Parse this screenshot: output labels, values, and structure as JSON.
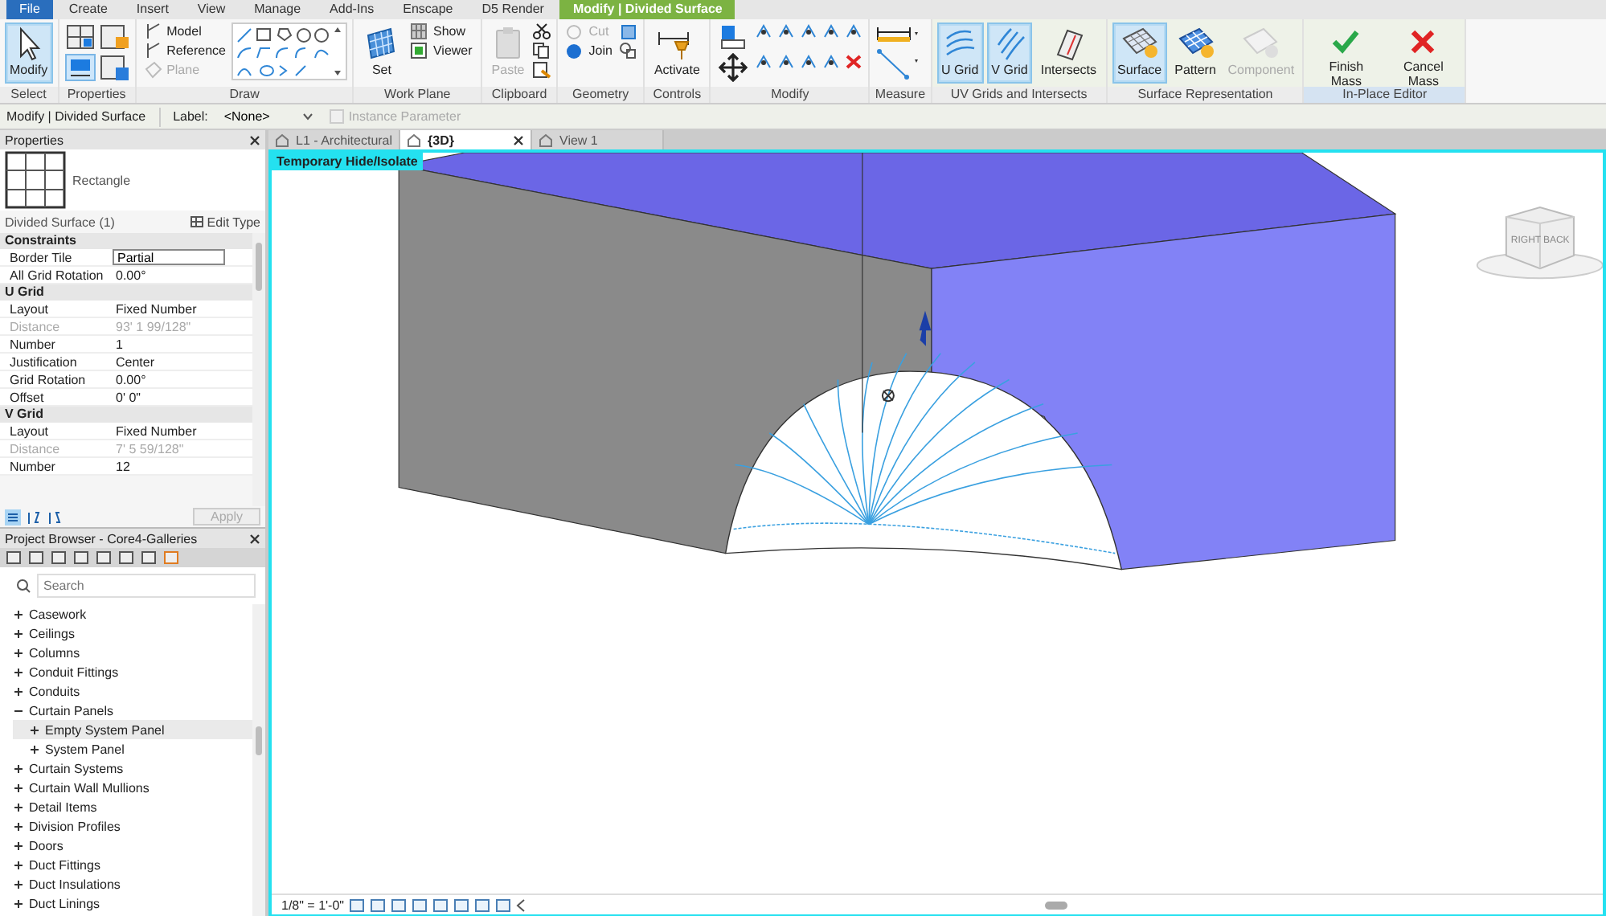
{
  "menu_tabs": [
    {
      "label": "File",
      "selected": false,
      "kind": "file"
    },
    {
      "label": "Create",
      "selected": false,
      "kind": "tab"
    },
    {
      "label": "Insert",
      "selected": false,
      "kind": "tab"
    },
    {
      "label": "View",
      "selected": false,
      "kind": "tab"
    },
    {
      "label": "Manage",
      "selected": false,
      "kind": "tab"
    },
    {
      "label": "Add-Ins",
      "selected": false,
      "kind": "tab"
    },
    {
      "label": "Enscape",
      "selected": false,
      "kind": "tab"
    },
    {
      "label": "D5 Render",
      "selected": false,
      "kind": "tab"
    },
    {
      "label": "Modify | Divided Surface",
      "selected": true,
      "kind": "context"
    }
  ],
  "ribbon": {
    "panels": [
      {
        "kind": "select",
        "title": "Select",
        "buttons": [
          {
            "label": "Modify",
            "kind": "large",
            "selected": true,
            "disabled": false
          }
        ]
      },
      {
        "kind": "properties",
        "title": "Properties"
      },
      {
        "kind": "draw",
        "title": "Draw",
        "buttons": [
          {
            "label": "Model",
            "kind": "small",
            "disabled": false
          },
          {
            "label": "Reference",
            "kind": "small",
            "disabled": false
          },
          {
            "label": "Plane",
            "kind": "small",
            "disabled": true
          }
        ]
      },
      {
        "kind": "work_plane",
        "title": "Work Plane",
        "buttons": [
          {
            "label": "Set",
            "kind": "large",
            "selected": false,
            "disabled": false
          },
          {
            "label": "Show",
            "kind": "small",
            "disabled": false
          },
          {
            "label": "Viewer",
            "kind": "small",
            "disabled": false
          }
        ]
      },
      {
        "kind": "clipboard",
        "title": "Clipboard",
        "buttons": [
          {
            "label": "Paste",
            "kind": "large",
            "selected": false,
            "disabled": true
          }
        ]
      },
      {
        "kind": "geometry",
        "title": "Geometry",
        "buttons": [
          {
            "label": "Cut",
            "kind": "small",
            "disabled": true
          },
          {
            "label": "Join",
            "kind": "small",
            "disabled": false
          }
        ]
      },
      {
        "kind": "controls",
        "title": "Controls",
        "buttons": [
          {
            "label": "Activate",
            "kind": "large",
            "selected": false,
            "disabled": false
          }
        ]
      },
      {
        "kind": "modify",
        "title": "Modify"
      },
      {
        "kind": "measure",
        "title": "Measure"
      },
      {
        "kind": "uv",
        "title": "UV Grids and Intersects",
        "buttons": [
          {
            "label": "U Grid",
            "kind": "large",
            "selected": true,
            "disabled": false
          },
          {
            "label": "V Grid",
            "kind": "large",
            "selected": true,
            "disabled": false
          },
          {
            "label": "Intersects",
            "kind": "large",
            "selected": false,
            "disabled": false
          }
        ]
      },
      {
        "kind": "surface",
        "title": "Surface Representation",
        "buttons": [
          {
            "label": "Surface",
            "kind": "large",
            "selected": true,
            "disabled": false
          },
          {
            "label": "Pattern",
            "kind": "large",
            "selected": false,
            "disabled": false
          },
          {
            "label": "Component",
            "kind": "large",
            "selected": false,
            "disabled": true
          }
        ]
      },
      {
        "kind": "editor",
        "title": "In-Place Editor",
        "buttons": [
          {
            "label": "Finish Mass",
            "kind": "large",
            "selected": false,
            "disabled": false
          },
          {
            "label": "Cancel Mass",
            "kind": "large",
            "selected": false,
            "disabled": false
          }
        ]
      }
    ]
  },
  "options_bar": {
    "context": "Modify | Divided Surface",
    "label_caption": "Label:",
    "label_value": "<None>",
    "instance_parameter": {
      "label": "Instance Parameter",
      "checked": false,
      "disabled": true
    }
  },
  "properties": {
    "title": "Properties",
    "type_name": "Rectangle",
    "selector": "Divided Surface (1)",
    "edit_type": "Edit Type",
    "apply": "Apply",
    "groups": [
      {
        "title": "Constraints",
        "rows": [
          {
            "label": "Border Tile",
            "value": "Partial",
            "kind": "field",
            "disabled": false
          },
          {
            "label": "All Grid Rotation",
            "value": "0.00°",
            "kind": "text",
            "disabled": false
          }
        ]
      },
      {
        "title": "U Grid",
        "rows": [
          {
            "label": "Layout",
            "value": "Fixed Number",
            "kind": "text",
            "disabled": false
          },
          {
            "label": "Distance",
            "value": "93'  1 99/128\"",
            "kind": "text",
            "disabled": true
          },
          {
            "label": "Number",
            "value": "1",
            "kind": "text",
            "disabled": false
          },
          {
            "label": "Justification",
            "value": "Center",
            "kind": "text",
            "disabled": false
          },
          {
            "label": "Grid Rotation",
            "value": "0.00°",
            "kind": "text",
            "disabled": false
          },
          {
            "label": "Offset",
            "value": "0'  0\"",
            "kind": "text",
            "disabled": false
          }
        ]
      },
      {
        "title": "V Grid",
        "rows": [
          {
            "label": "Layout",
            "value": "Fixed Number",
            "kind": "text",
            "disabled": false
          },
          {
            "label": "Distance",
            "value": "7'  5 59/128\"",
            "kind": "text",
            "disabled": true
          },
          {
            "label": "Number",
            "value": "12",
            "kind": "text",
            "disabled": false
          }
        ]
      }
    ]
  },
  "project_browser": {
    "title": "Project Browser - Core4-Galleries",
    "search": {
      "placeholder": "Search"
    },
    "items": [
      {
        "label": "Casework",
        "expanded": false,
        "selected": false
      },
      {
        "label": "Ceilings",
        "expanded": false,
        "selected": false
      },
      {
        "label": "Columns",
        "expanded": false,
        "selected": false
      },
      {
        "label": "Conduit Fittings",
        "expanded": false,
        "selected": false
      },
      {
        "label": "Conduits",
        "expanded": false,
        "selected": false
      },
      {
        "label": "Curtain Panels",
        "expanded": true,
        "selected": false,
        "children": [
          {
            "label": "Empty System Panel",
            "expanded": false,
            "selected": true
          },
          {
            "label": "System Panel",
            "expanded": false,
            "selected": false
          }
        ]
      },
      {
        "label": "Curtain Systems",
        "expanded": false,
        "selected": false
      },
      {
        "label": "Curtain Wall Mullions",
        "expanded": false,
        "selected": false
      },
      {
        "label": "Detail Items",
        "expanded": false,
        "selected": false
      },
      {
        "label": "Division Profiles",
        "expanded": false,
        "selected": false
      },
      {
        "label": "Doors",
        "expanded": false,
        "selected": false
      },
      {
        "label": "Duct Fittings",
        "expanded": false,
        "selected": false
      },
      {
        "label": "Duct Insulations",
        "expanded": false,
        "selected": false
      },
      {
        "label": "Duct Linings",
        "expanded": false,
        "selected": false
      }
    ]
  },
  "view_tabs": [
    {
      "label": "L1 - Architectural",
      "selected": false
    },
    {
      "label": "{3D}",
      "selected": true
    },
    {
      "label": "View 1",
      "selected": false
    }
  ],
  "viewport": {
    "mode_badge": "Temporary Hide/Isolate",
    "view_cube": {
      "faces": [
        "RIGHT",
        "BACK"
      ]
    },
    "scale": "1/8\" = 1'-0\""
  }
}
